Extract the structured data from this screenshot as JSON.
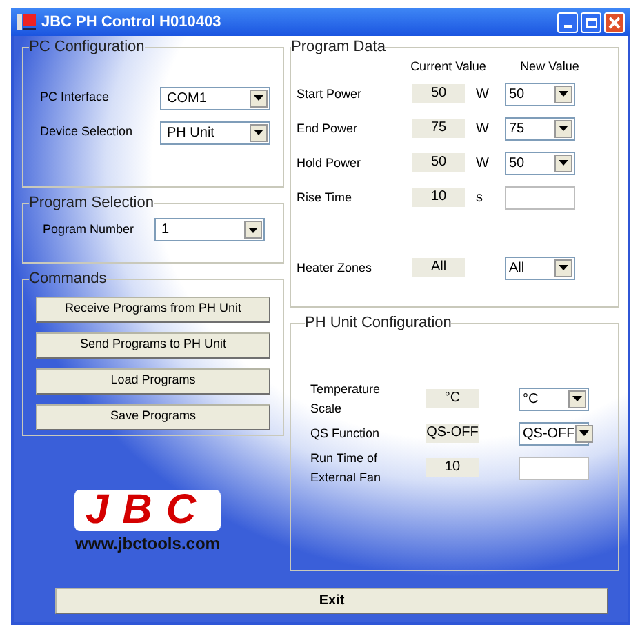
{
  "window": {
    "title": "JBC PH Control H010403"
  },
  "pc_configuration": {
    "title": "PC Configuration",
    "fields": [
      {
        "label": "PC Interface",
        "value": "COM1"
      },
      {
        "label": "Device Selection",
        "value": "PH Unit"
      }
    ]
  },
  "program_selection": {
    "title": "Program Selection",
    "fields": [
      {
        "label": "Pogram Number",
        "value": "1"
      }
    ]
  },
  "commands": {
    "title": "Commands",
    "buttons": [
      "Receive Programs from PH Unit",
      "Send Programs to PH Unit",
      "Load Programs",
      "Save Programs"
    ]
  },
  "logo": {
    "text": "JBC",
    "url": "www.jbctools.com"
  },
  "program_data": {
    "title": "Program Data",
    "columns": [
      "Current Value",
      "New Value"
    ],
    "rows": [
      {
        "label": "Start Power",
        "current": "50",
        "unit": "W",
        "kind": "select",
        "new_value": "50"
      },
      {
        "label": "End Power",
        "current": "75",
        "unit": "W",
        "kind": "select",
        "new_value": "75"
      },
      {
        "label": "Hold Power",
        "current": "50",
        "unit": "W",
        "kind": "select",
        "new_value": "50"
      },
      {
        "label": "Rise Time",
        "current": "10",
        "unit": "s",
        "kind": "input"
      },
      {
        "label": "Heater Zones",
        "current": "All",
        "kind": "select",
        "new_value": "All"
      }
    ]
  },
  "ph_unit_configuration": {
    "title": "PH Unit Configuration",
    "rows": [
      {
        "label": "Temperature Scale",
        "current": "°C",
        "kind": "select",
        "new_value": "°C"
      },
      {
        "label": "QS Function",
        "current": "QS-OFF",
        "kind": "select",
        "new_value": "QS-OFF"
      },
      {
        "label": "Run Time of External Fan",
        "current": "10",
        "kind": "input"
      }
    ]
  },
  "exit_button": "Exit"
}
